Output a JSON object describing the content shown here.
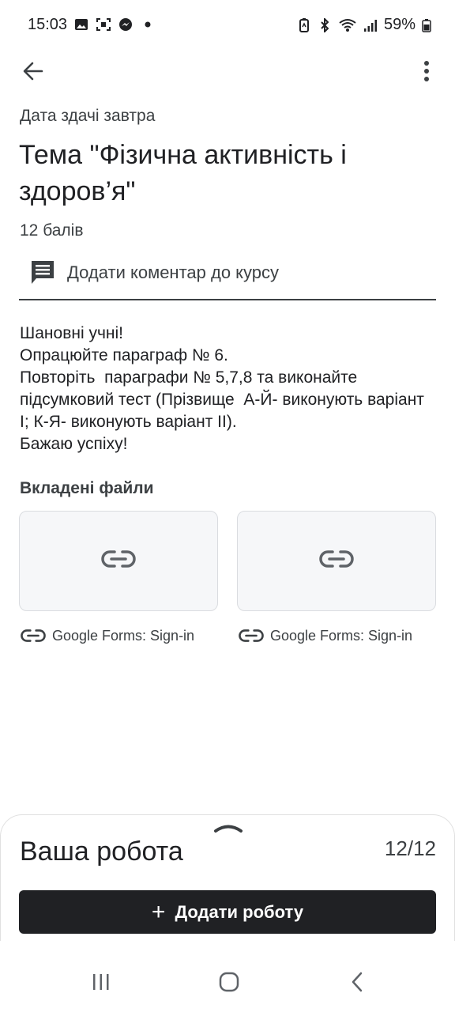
{
  "status_bar": {
    "time": "15:03",
    "battery": "59%",
    "left_icons": [
      "image-icon",
      "screenshot-icon",
      "messenger-icon",
      "dot-icon"
    ],
    "right_icons": [
      "battery-saver-icon",
      "bluetooth-icon",
      "wifi-icon",
      "signal-icon",
      "battery-icon"
    ]
  },
  "app_bar": {
    "back_icon": "arrow-back-icon",
    "more_icon": "more-vert-icon"
  },
  "assignment": {
    "due": "Дата здачі завтра",
    "title": "Тема \"Фізична активність і здоров’я\"",
    "points": "12 балів",
    "comment_label": "Додати коментар до курсу",
    "instructions": [
      "Шановні учні!",
      "Опрацюйте параграф № 6.",
      "Повторіть  параграфи № 5,7,8 та виконайте підсумковий тест (Прізвище  А-Й- виконують варіант І; К-Я- виконують варіант ІІ).",
      "Бажаю успіху!"
    ]
  },
  "attachments": {
    "title": "Вкладені файли",
    "items": [
      {
        "label": "Google Forms: Sign-in",
        "icon": "link-icon"
      },
      {
        "label": "Google Forms: Sign-in",
        "icon": "link-icon"
      }
    ]
  },
  "your_work": {
    "title": "Ваша робота",
    "count": "12/12",
    "add_button": "Додати роботу",
    "add_icon": "+"
  },
  "nav_bar": {
    "icons": [
      "recents-icon",
      "home-icon",
      "back-icon"
    ]
  },
  "colors": {
    "text": "#202124",
    "secondary": "#3c4043",
    "button": "#202124",
    "card": "#f6f7f9"
  }
}
